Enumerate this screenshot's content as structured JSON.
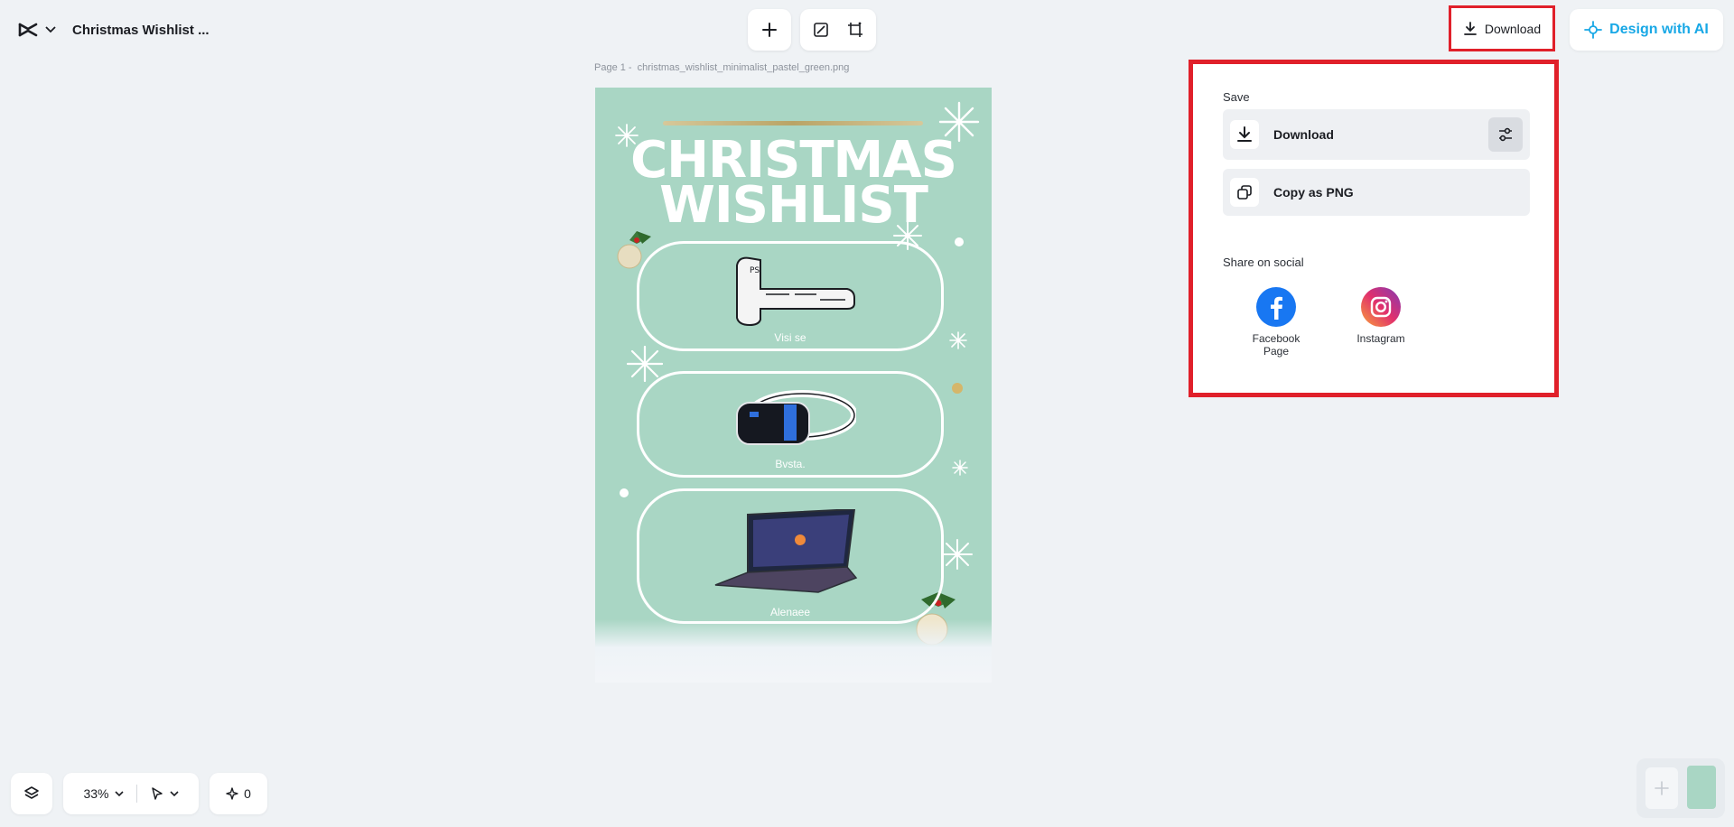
{
  "header": {
    "doc_title": "Christmas Wishlist ...",
    "download_label": "Download",
    "design_ai_label": "Design with AI"
  },
  "toolbar": {
    "icons": [
      "plus-icon",
      "resize-icon",
      "crop-icon"
    ]
  },
  "canvas": {
    "page_label": "Page 1 -",
    "file_name": "christmas_wishlist_minimalist_pastel_green.png",
    "design": {
      "title_line1": "CHRISTMAS",
      "title_line2": "WISHLIST",
      "items": [
        {
          "label": "Visi  se",
          "image": "ps-vr2-controller"
        },
        {
          "label": "Bvsta.",
          "image": "vr-headset"
        },
        {
          "label": "Alenaee",
          "image": "laptop"
        }
      ],
      "background": "#a9d6c4"
    }
  },
  "dropdown": {
    "save_heading": "Save",
    "download_label": "Download",
    "copy_png_label": "Copy as PNG",
    "share_heading": "Share on social",
    "socials": [
      {
        "label_line1": "Facebook",
        "label_line2": "Page",
        "icon": "facebook-icon"
      },
      {
        "label_line1": "Instagram",
        "label_line2": "",
        "icon": "instagram-icon"
      }
    ]
  },
  "bottom": {
    "zoom": "33%",
    "count": "0"
  },
  "colors": {
    "accent_ai": "#18a8e6",
    "highlight": "#e0202a",
    "facebook": "#1877f2"
  }
}
